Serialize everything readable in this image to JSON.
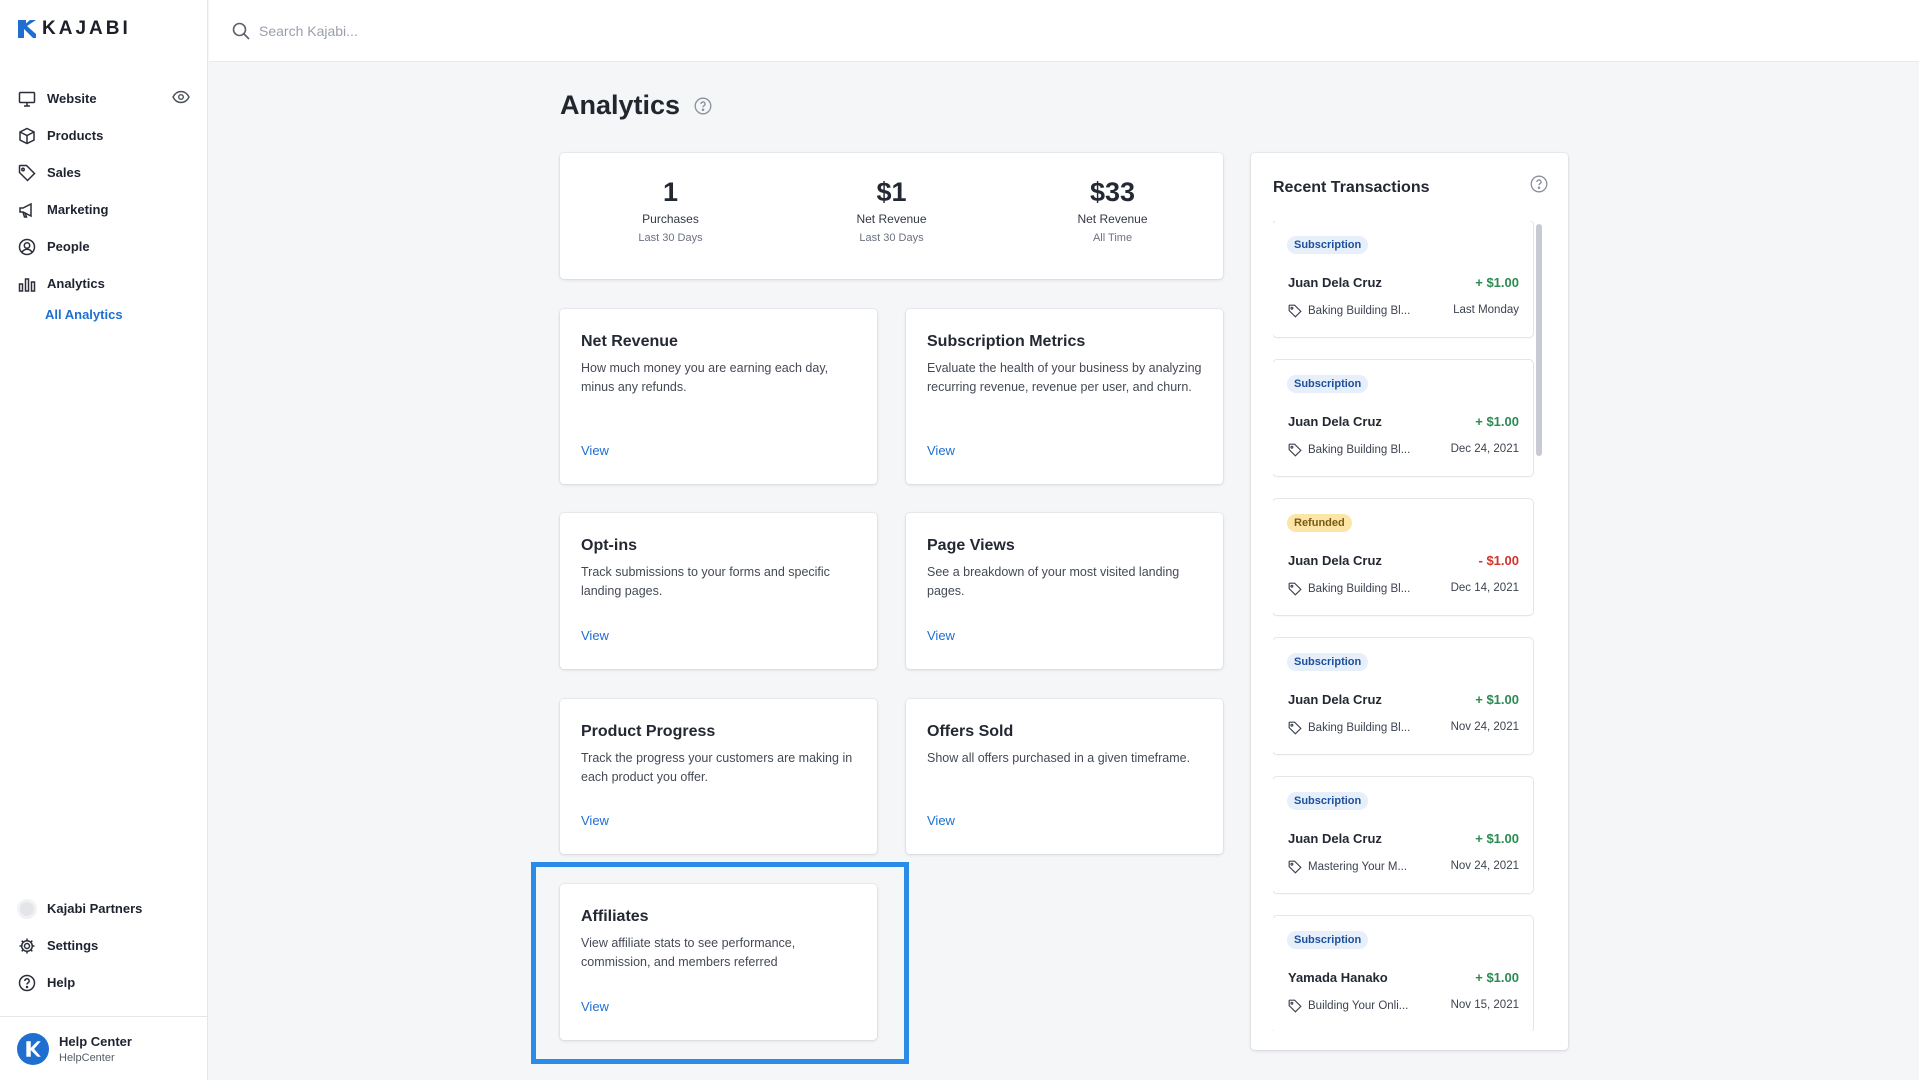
{
  "brand": {
    "logo_text": "KAJABI",
    "accent": "#1f6fd1",
    "highlight": "#2b8ce8"
  },
  "search": {
    "placeholder": "Search Kajabi..."
  },
  "sidebar": {
    "items": [
      {
        "label": "Website",
        "icon": "monitor-icon"
      },
      {
        "label": "Products",
        "icon": "box-icon"
      },
      {
        "label": "Sales",
        "icon": "tag-icon"
      },
      {
        "label": "Marketing",
        "icon": "megaphone-icon"
      },
      {
        "label": "People",
        "icon": "user-circle-icon"
      },
      {
        "label": "Analytics",
        "icon": "bar-chart-icon"
      }
    ],
    "sub_item": "All Analytics",
    "bottom": [
      {
        "label": "Kajabi Partners",
        "icon": "partner-icon"
      },
      {
        "label": "Settings",
        "icon": "gear-icon"
      },
      {
        "label": "Help",
        "icon": "help-icon"
      }
    ],
    "account": {
      "name": "Help Center",
      "sub": "HelpCenter"
    }
  },
  "page": {
    "title": "Analytics"
  },
  "stats": [
    {
      "value": "1",
      "label": "Purchases",
      "period": "Last 30 Days"
    },
    {
      "value": "$1",
      "label": "Net Revenue",
      "period": "Last 30 Days"
    },
    {
      "value": "$33",
      "label": "Net Revenue",
      "period": "All Time"
    }
  ],
  "reports": [
    {
      "title": "Net Revenue",
      "desc": "How much money you are earning each day, minus any refunds.",
      "view": "View"
    },
    {
      "title": "Subscription Metrics",
      "desc": "Evaluate the health of your business by analyzing recurring revenue, revenue per user, and churn.",
      "view": "View"
    },
    {
      "title": "Opt-ins",
      "desc": "Track submissions to your forms and specific landing pages.",
      "view": "View"
    },
    {
      "title": "Page Views",
      "desc": "See a breakdown of your most visited landing pages.",
      "view": "View"
    },
    {
      "title": "Product Progress",
      "desc": "Track the progress your customers are making in each product you offer.",
      "view": "View"
    },
    {
      "title": "Offers Sold",
      "desc": "Show all offers purchased in a given timeframe.",
      "view": "View"
    },
    {
      "title": "Affiliates",
      "desc": "View affiliate stats to see performance, commission, and members referred",
      "view": "View"
    }
  ],
  "transactions": {
    "title": "Recent Transactions",
    "items": [
      {
        "badge": "Subscription",
        "name": "Juan Dela Cruz",
        "amount": "+ $1.00",
        "product": "Baking Building Bl...",
        "date": "Last Monday"
      },
      {
        "badge": "Subscription",
        "name": "Juan Dela Cruz",
        "amount": "+ $1.00",
        "product": "Baking Building Bl...",
        "date": "Dec 24, 2021"
      },
      {
        "badge": "Refunded",
        "name": "Juan Dela Cruz",
        "amount": "- $1.00",
        "product": "Baking Building Bl...",
        "date": "Dec 14, 2021"
      },
      {
        "badge": "Subscription",
        "name": "Juan Dela Cruz",
        "amount": "+ $1.00",
        "product": "Baking Building Bl...",
        "date": "Nov 24, 2021"
      },
      {
        "badge": "Subscription",
        "name": "Juan Dela Cruz",
        "amount": "+ $1.00",
        "product": "Mastering Your M...",
        "date": "Nov 24, 2021"
      },
      {
        "badge": "Subscription",
        "name": "Yamada Hanako",
        "amount": "+ $1.00",
        "product": "Building Your Onli...",
        "date": "Nov 15, 2021"
      }
    ]
  }
}
